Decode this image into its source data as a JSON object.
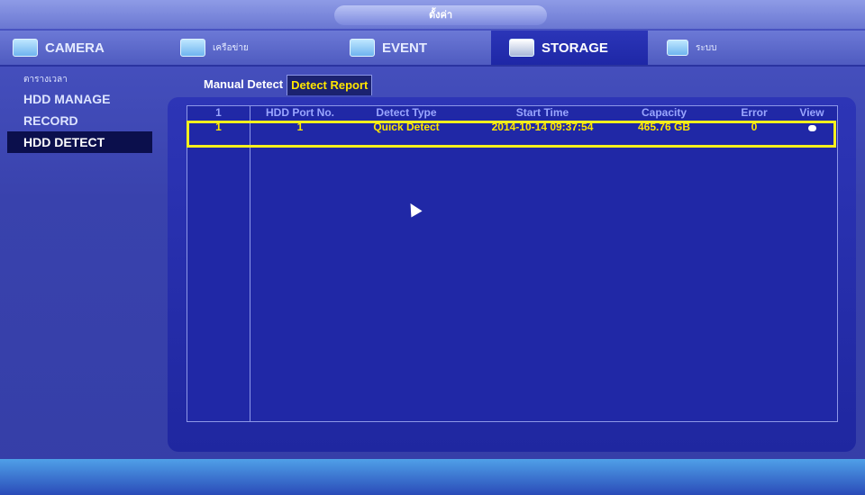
{
  "window": {
    "title": "ตั้งค่า"
  },
  "main_tabs": [
    {
      "label": "CAMERA",
      "icon": "camera-icon"
    },
    {
      "label": "เครือข่าย",
      "icon": "network-icon"
    },
    {
      "label": "EVENT",
      "icon": "event-icon"
    },
    {
      "label": "STORAGE",
      "icon": "storage-icon",
      "active": true
    },
    {
      "label": "ระบบ",
      "icon": "system-icon"
    }
  ],
  "left_menu": [
    {
      "label": "ตารางเวลา"
    },
    {
      "label": "HDD MANAGE"
    },
    {
      "label": "RECORD"
    },
    {
      "label": "HDD DETECT",
      "active": true
    }
  ],
  "sub_tabs": [
    {
      "label": "Manual Detect"
    },
    {
      "label": "Detect Report",
      "active": true
    }
  ],
  "table": {
    "headers": [
      "1",
      "HDD Port No.",
      "Detect Type",
      "Start Time",
      "Capacity",
      "Error",
      "View"
    ],
    "rows": [
      {
        "index": "1",
        "port": "1",
        "type": "Quick Detect",
        "start_time": "2014-10-14 09:37:54",
        "capacity": "465.76 GB",
        "error": "0",
        "view_icon": "magnifier-icon"
      }
    ]
  },
  "colors": {
    "accent_yellow": "#ffe600",
    "highlight": "#f5f01d",
    "clock_orange": "#ff9a1f"
  }
}
